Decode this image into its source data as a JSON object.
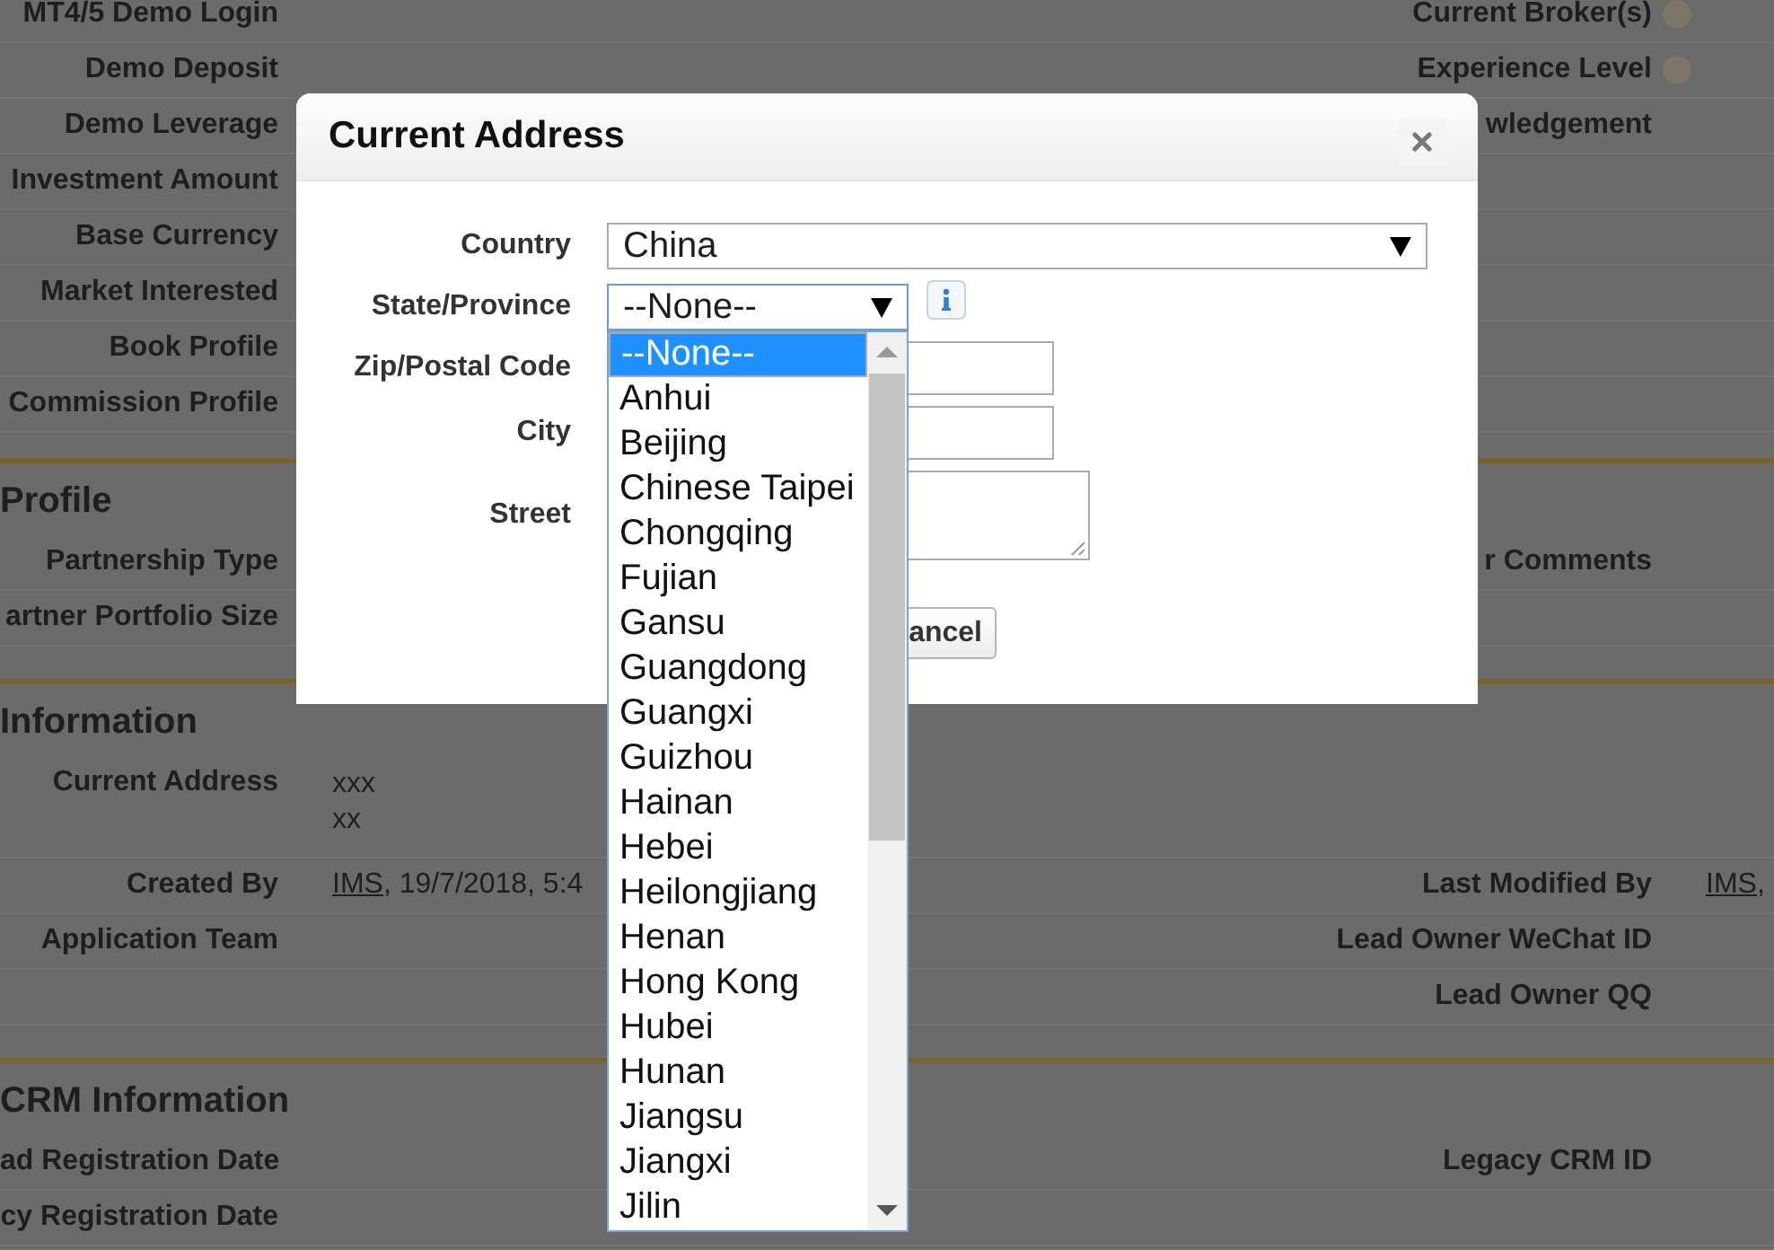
{
  "sections": [
    {
      "rows": [
        {
          "label": "MT4/5 Demo Login",
          "right_label": "Current Broker(s)",
          "help_icon": true
        },
        {
          "label": "Demo Deposit",
          "right_label": "Experience Level",
          "help_icon": true
        },
        {
          "label": "Demo Leverage",
          "right_label": "wledgement"
        },
        {
          "label": "Investment Amount"
        },
        {
          "label": "Base Currency"
        },
        {
          "label": "Market Interested"
        },
        {
          "label": "Book Profile"
        },
        {
          "label": "Commission Profile"
        }
      ]
    },
    {
      "heading": "Profile",
      "rows": [
        {
          "label": "Partnership Type",
          "right_label": "r Comments"
        },
        {
          "label": "artner Portfolio Size"
        }
      ]
    },
    {
      "heading": "Information",
      "rows": [
        {
          "label": "Current Address",
          "value_lines": [
            "xxx",
            "xx"
          ]
        },
        {
          "label": "Created By",
          "value": {
            "link": "IMS",
            "text": ", 19/7/2018, 5:4"
          },
          "right_label": "Last Modified By",
          "right_value": {
            "link": "IMS",
            "text": ","
          }
        },
        {
          "label": "Application Team",
          "right_label": "Lead Owner WeChat ID"
        },
        {
          "right_label": "Lead Owner QQ"
        }
      ]
    },
    {
      "heading": "CRM Information",
      "rows": [
        {
          "label": "ad Registration Date",
          "right_label": "Legacy CRM ID"
        },
        {
          "label": "cy Registration Date"
        }
      ]
    }
  ],
  "dialog": {
    "title": "Current Address",
    "fields": [
      {
        "label": "Country",
        "kind": "select",
        "value": "China"
      },
      {
        "label": "State/Province",
        "kind": "select-open",
        "value": "--None--",
        "info": true
      },
      {
        "label": "Zip/Postal Code",
        "kind": "input"
      },
      {
        "label": "City",
        "kind": "input"
      },
      {
        "label": "Street",
        "kind": "textarea"
      }
    ],
    "buttons": [
      "ancel"
    ],
    "dropdown": {
      "options": [
        {
          "label": "--None--",
          "selected": true
        },
        {
          "label": "Anhui",
          "selected": false
        },
        {
          "label": "Beijing",
          "selected": false
        },
        {
          "label": "Chinese Taipei",
          "selected": false
        },
        {
          "label": "Chongqing",
          "selected": false
        },
        {
          "label": "Fujian",
          "selected": false
        },
        {
          "label": "Gansu",
          "selected": false
        },
        {
          "label": "Guangdong",
          "selected": false
        },
        {
          "label": "Guangxi",
          "selected": false
        },
        {
          "label": "Guizhou",
          "selected": false
        },
        {
          "label": "Hainan",
          "selected": false
        },
        {
          "label": "Hebei",
          "selected": false
        },
        {
          "label": "Heilongjiang",
          "selected": false
        },
        {
          "label": "Henan",
          "selected": false
        },
        {
          "label": "Hong Kong",
          "selected": false
        },
        {
          "label": "Hubei",
          "selected": false
        },
        {
          "label": "Hunan",
          "selected": false
        },
        {
          "label": "Jiangsu",
          "selected": false
        },
        {
          "label": "Jiangxi",
          "selected": false
        },
        {
          "label": "Jilin",
          "selected": false
        }
      ]
    }
  }
}
